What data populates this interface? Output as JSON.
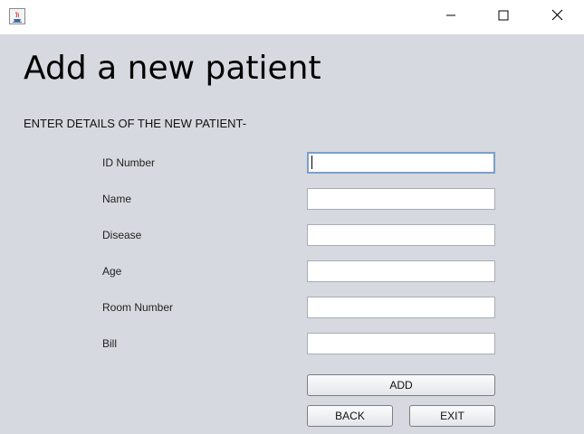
{
  "window": {
    "title": "",
    "controls": {
      "minimize_icon": "minimize-icon",
      "maximize_icon": "maximize-icon",
      "close_icon": "close-icon"
    }
  },
  "form": {
    "heading": "Add a new patient",
    "subheading": "ENTER DETAILS OF THE NEW PATIENT-",
    "fields": [
      {
        "label": "ID Number",
        "value": ""
      },
      {
        "label": "Name",
        "value": ""
      },
      {
        "label": "Disease",
        "value": ""
      },
      {
        "label": "Age",
        "value": ""
      },
      {
        "label": "Room Number",
        "value": ""
      },
      {
        "label": "Bill",
        "value": ""
      }
    ],
    "buttons": {
      "add": "ADD",
      "back": "BACK",
      "exit": "EXIT"
    }
  },
  "colors": {
    "background": "#d6d9df",
    "titlebar": "#ffffff",
    "focus_border": "#7b9fc9"
  }
}
